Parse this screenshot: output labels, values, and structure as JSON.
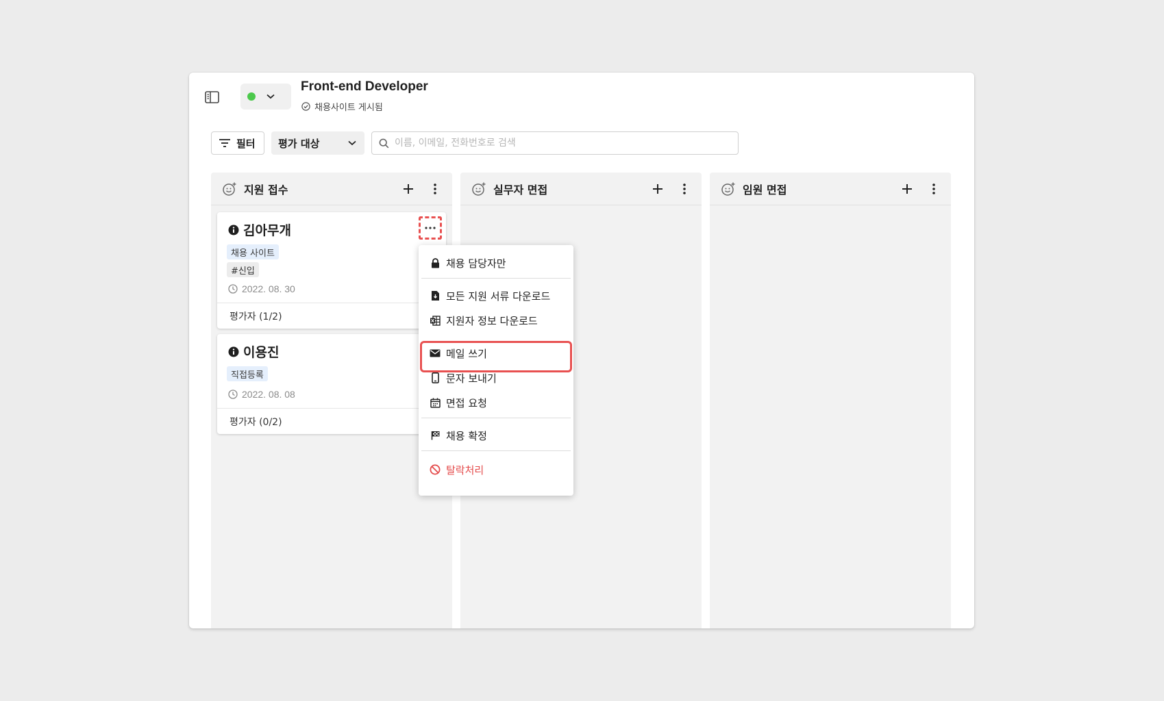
{
  "header": {
    "job_title": "Front-end Developer",
    "job_status": "채용사이트 게시됨",
    "status_color": "#4cc94c"
  },
  "toolbar": {
    "filter_label": "필터",
    "eval_select_value": "평가 대상",
    "search_placeholder": "이름, 이메일, 전화번호로 검색"
  },
  "columns": [
    {
      "title": "지원 접수"
    },
    {
      "title": "실무자 면접"
    },
    {
      "title": "임원 면접"
    }
  ],
  "cards": [
    {
      "name": "김아무개",
      "tags": [
        "채용 사이트",
        "#신입"
      ],
      "date": "2022. 08. 30",
      "evaluators": "평가자 (1/2)"
    },
    {
      "name": "이용진",
      "tags": [
        "직접등록"
      ],
      "date": "2022. 08. 08",
      "evaluators": "평가자 (0/2)"
    }
  ],
  "context_menu": {
    "items": [
      {
        "label": "채용 담당자만",
        "icon": "lock-icon"
      },
      {
        "label": "모든 지원 서류 다운로드",
        "icon": "file-download-icon"
      },
      {
        "label": "지원자 정보 다운로드",
        "icon": "excel-icon"
      },
      {
        "label": "메일 쓰기",
        "icon": "mail-icon"
      },
      {
        "label": "문자 보내기",
        "icon": "phone-icon"
      },
      {
        "label": "면접 요청",
        "icon": "calendar-icon"
      },
      {
        "label": "채용 확정",
        "icon": "flag-icon"
      },
      {
        "label": "탈락처리",
        "icon": "ban-icon"
      }
    ],
    "highlighted": "메일 쓰기",
    "danger_color": "#e44b4b"
  }
}
